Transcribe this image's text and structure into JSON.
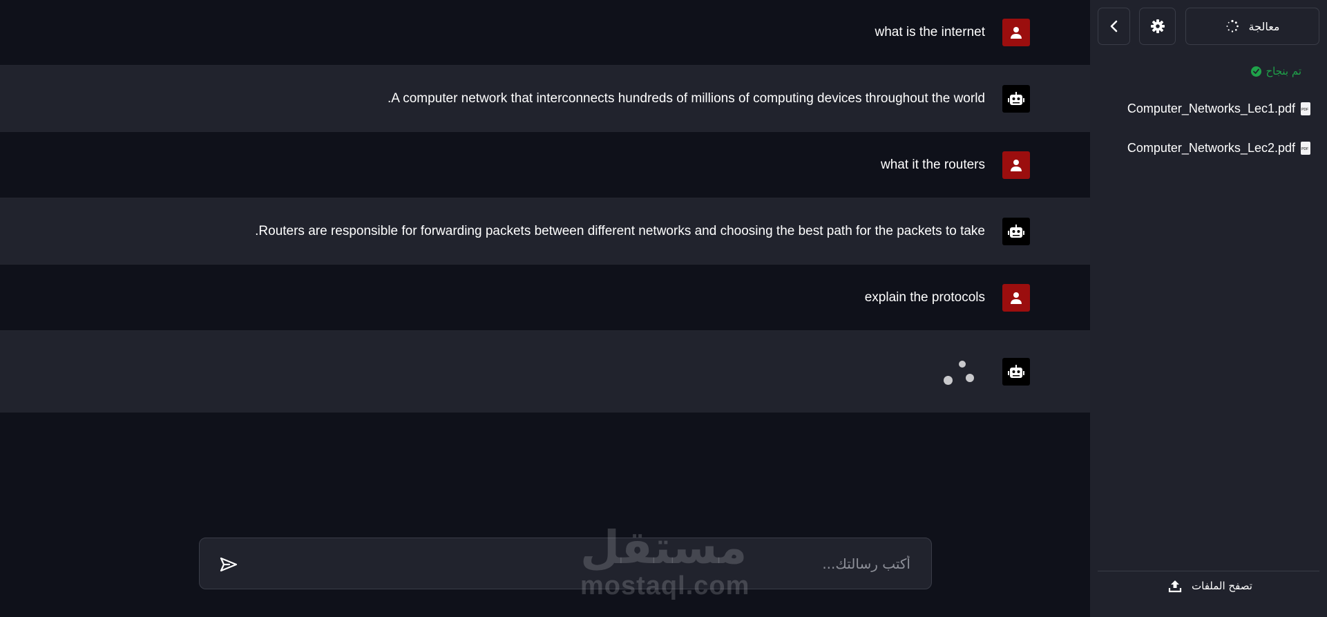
{
  "messages": [
    {
      "role": "user",
      "text": "what is the internet"
    },
    {
      "role": "bot",
      "text": ".A computer network that interconnects hundreds of millions of computing devices throughout the world"
    },
    {
      "role": "user",
      "text": "what it the routers"
    },
    {
      "role": "bot",
      "text": ".Routers are responsible for forwarding packets between different networks and choosing the best path for the packets to take"
    },
    {
      "role": "user",
      "text": "explain the protocols"
    },
    {
      "role": "bot",
      "text": ""
    }
  ],
  "composer": {
    "placeholder": "أكتب رسالتك..."
  },
  "watermark": {
    "arabic": "مستقل",
    "latin": "mostaql.com"
  },
  "sidebar": {
    "process_label": "معالجة",
    "status_text": "تم بنجاح",
    "files": [
      "Computer_Networks_Lec1.pdf",
      "Computer_Networks_Lec2.pdf"
    ],
    "upload_label": "تصفح الملفات"
  },
  "colors": {
    "background": "#0f111a",
    "bot_row": "#21232d",
    "user_avatar": "#9b0e0e",
    "bot_avatar": "#000000",
    "success": "#1fa34a",
    "sidebar": "#20222c"
  },
  "icons": {
    "user_avatar": "user-icon",
    "bot_avatar": "robot-icon",
    "send": "send-icon",
    "collapse": "chevron-left-icon",
    "settings": "gear-icon",
    "processing": "spinner-icon",
    "success": "check-circle-icon",
    "file": "pdf-file-icon",
    "upload": "upload-icon"
  }
}
